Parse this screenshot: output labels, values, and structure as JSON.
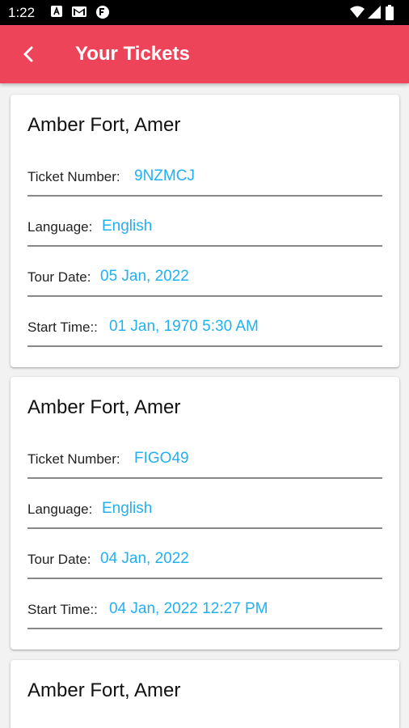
{
  "status_bar": {
    "time": "1:22",
    "left_icons": [
      "a-notification-icon",
      "gmail-icon",
      "vpn-key-icon"
    ],
    "right_icons": [
      "wifi-icon",
      "signal-icon",
      "battery-icon"
    ]
  },
  "app_bar": {
    "title": "Your Tickets",
    "back_icon": "chevron-left-icon",
    "background": "#ee4459"
  },
  "colors": {
    "value": "#22b0f0"
  },
  "tickets": [
    {
      "title": "Amber Fort, Amer",
      "ticket_number_label": "Ticket Number:",
      "ticket_number": "9NZMCJ",
      "language_label": "Language:",
      "language": "English",
      "tour_date_label": "Tour Date:",
      "tour_date": "05 Jan, 2022",
      "start_time_label": "Start Time::",
      "start_time": "01 Jan, 1970 5:30 AM"
    },
    {
      "title": "Amber Fort, Amer",
      "ticket_number_label": "Ticket Number:",
      "ticket_number": "FIGO49",
      "language_label": "Language:",
      "language": "English",
      "tour_date_label": "Tour Date:",
      "tour_date": "04 Jan, 2022",
      "start_time_label": "Start Time::",
      "start_time": "04 Jan, 2022 12:27 PM"
    },
    {
      "title": "Amber Fort, Amer"
    }
  ]
}
